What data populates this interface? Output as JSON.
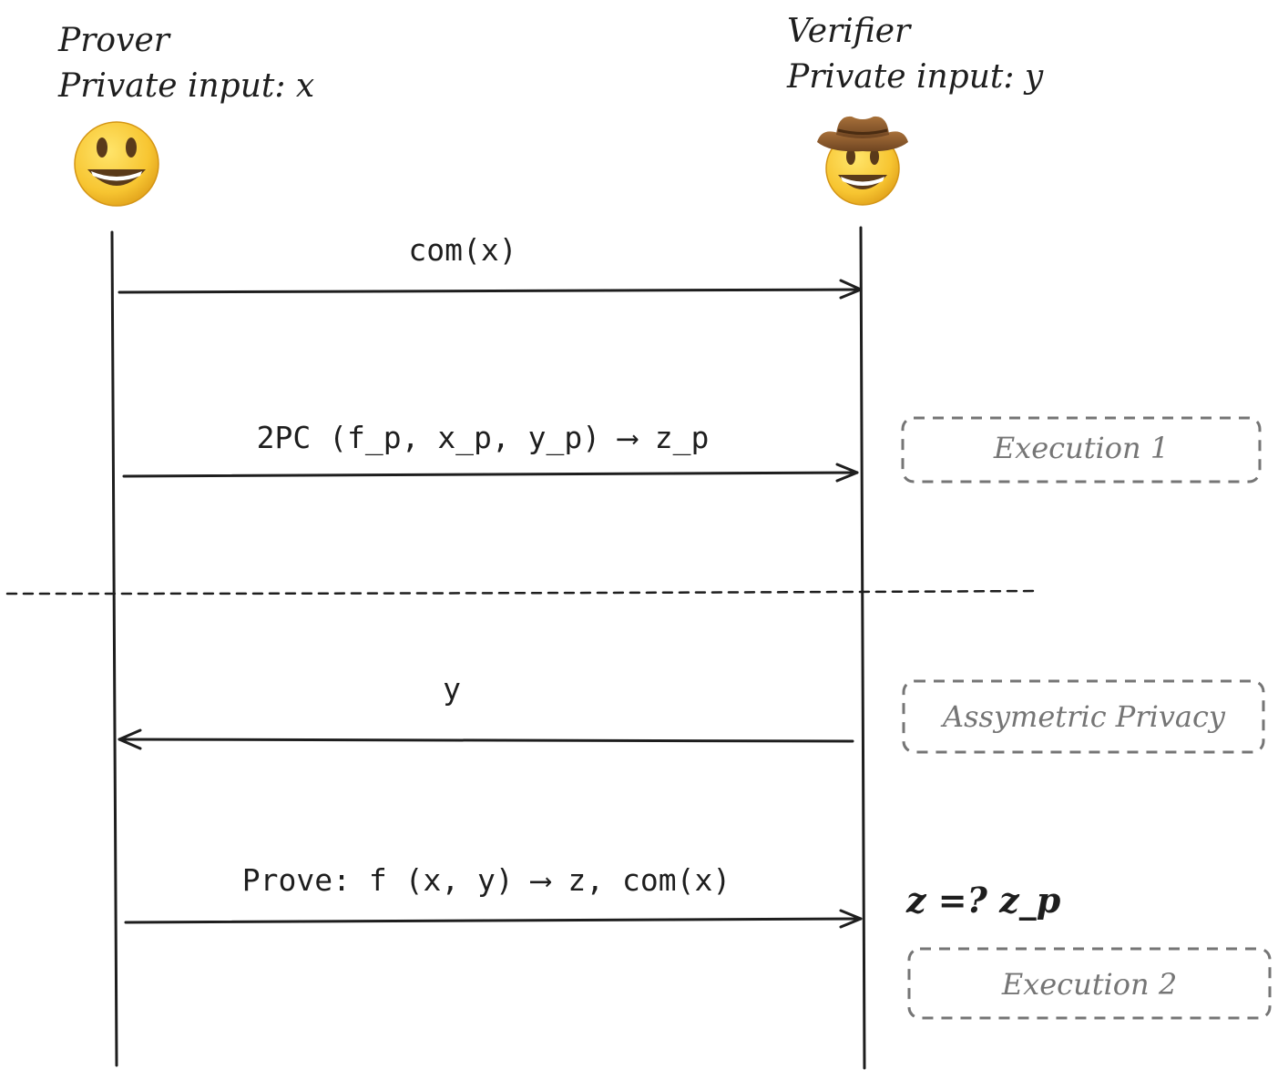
{
  "participants": {
    "prover": {
      "name": "Prover",
      "private_input": "Private input: x",
      "avatar_icon": "grinning-face-icon"
    },
    "verifier": {
      "name": "Verifier",
      "private_input": "Private input: y",
      "avatar_icon": "cowboy-hat-face-icon"
    }
  },
  "messages": [
    {
      "label": "com(x)",
      "direction": "prover-to-verifier"
    },
    {
      "label": "2PC (f_p, x_p, y_p) ⟶ z_p",
      "direction": "prover-to-verifier"
    },
    {
      "label": "y",
      "direction": "verifier-to-prover"
    },
    {
      "label": "Prove: f (x, y) ⟶ z, com(x)",
      "direction": "prover-to-verifier"
    }
  ],
  "annotations": {
    "execution_1": "Execution 1",
    "asymmetric_privacy": "Assymetric Privacy",
    "check": "z =? z_p",
    "execution_2": "Execution 2"
  },
  "colors": {
    "ink": "#1e1e1e",
    "box_label": "#757575",
    "emoji_face": "#f7c531",
    "hat": "#8a5a2b"
  }
}
